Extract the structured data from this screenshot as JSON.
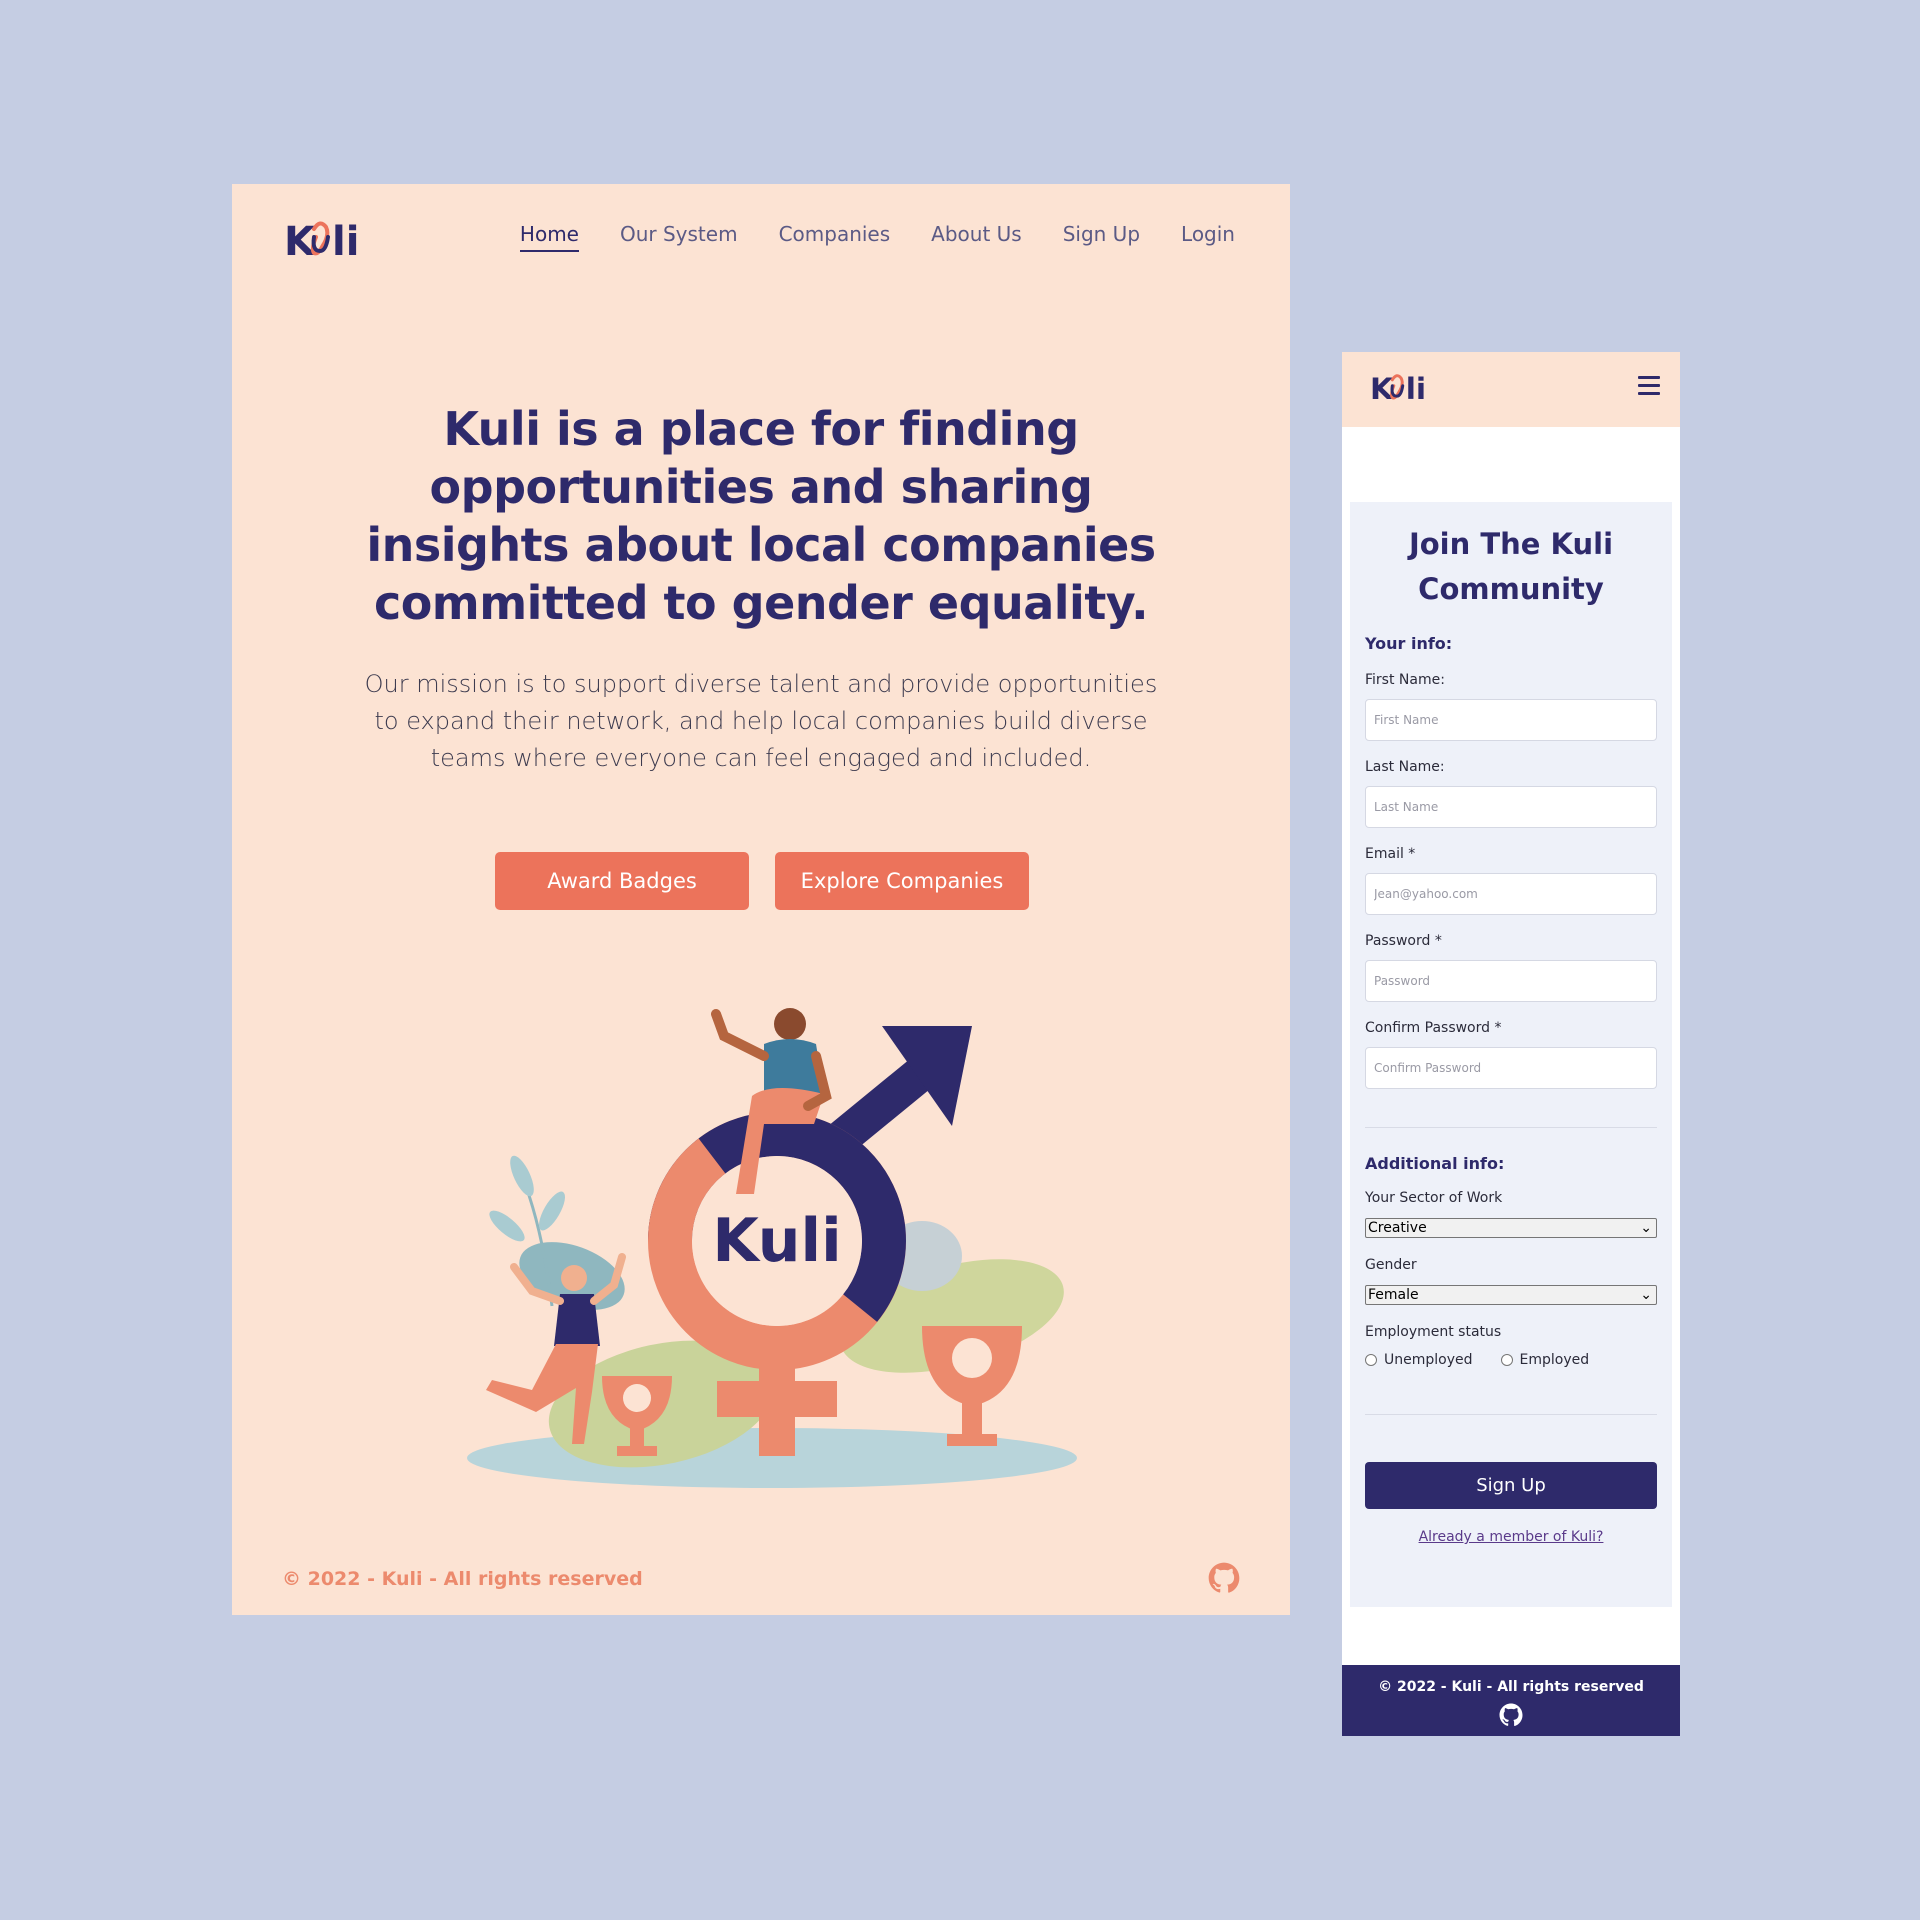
{
  "brand": {
    "name": "Kuli",
    "colors": {
      "navy": "#2e2a6b",
      "coral": "#ec735b",
      "peach": "#fce3d3",
      "backdrop": "#c5cde3"
    }
  },
  "desktop": {
    "logo_text": "Kuli",
    "nav": [
      {
        "label": "Home",
        "active": true
      },
      {
        "label": "Our System"
      },
      {
        "label": "Companies"
      },
      {
        "label": "About Us"
      },
      {
        "label": "Sign Up"
      },
      {
        "label": "Login"
      }
    ],
    "hero": {
      "title": "Kuli is a place for finding opportunities and sharing insights about local companies committed to gender equality.",
      "subtitle": "Our mission is to support diverse talent and provide opportunities to expand their network, and help local companies build diverse teams where everyone can feel engaged and included."
    },
    "buttons": {
      "primary": "Award Badges",
      "secondary": "Explore Companies"
    },
    "illustration_logo": "Kuli",
    "footer": {
      "copyright": "© 2022 - Kuli - All rights reserved",
      "icon": "github-icon"
    }
  },
  "mobile": {
    "logo_text": "Kuli",
    "menu_icon": "hamburger-menu-icon",
    "form": {
      "title": "Join The Kuli Community",
      "section_your_info": "Your info:",
      "first_name_label": "First Name:",
      "first_name_placeholder": "First Name",
      "last_name_label": "Last Name:",
      "last_name_placeholder": "Last Name",
      "email_label": "Email *",
      "email_placeholder": "Jean@yahoo.com",
      "password_label": "Password *",
      "password_placeholder": "Password",
      "confirm_password_label": "Confirm Password *",
      "confirm_password_placeholder": "Confirm Password",
      "section_additional": "Additional info:",
      "sector_label": "Your Sector of Work",
      "sector_value": "Creative",
      "gender_label": "Gender",
      "gender_value": "Female",
      "employment_label": "Employment status",
      "employment_options": [
        "Unemployed",
        "Employed"
      ],
      "submit": "Sign Up",
      "member_link": "Already a member of Kuli?"
    },
    "footer": {
      "copyright": "© 2022 - Kuli - All rights reserved",
      "icon": "github-icon"
    }
  }
}
